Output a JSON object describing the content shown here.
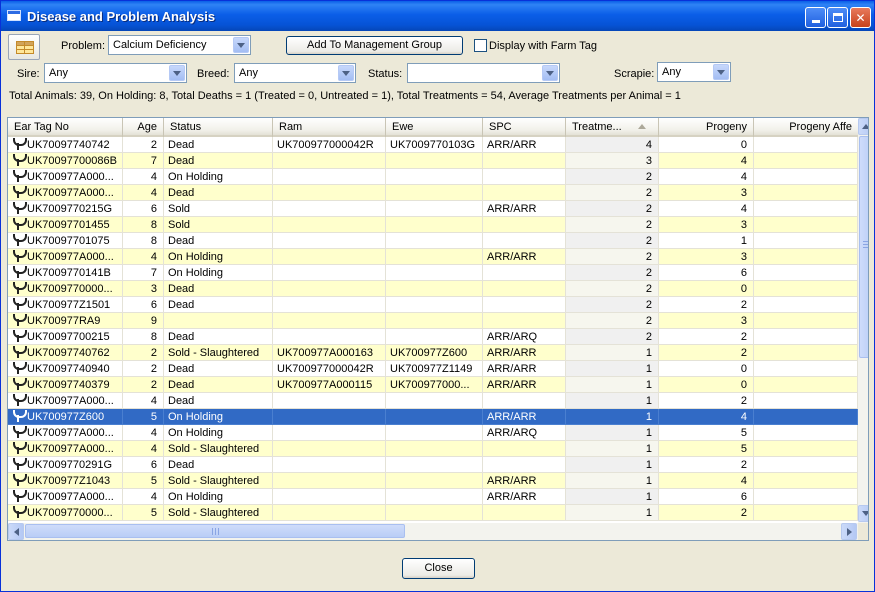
{
  "window": {
    "title": "Disease and Problem Analysis"
  },
  "toolbar": {
    "problem_label": "Problem:",
    "problem_value": "Calcium Deficiency",
    "add_button": "Add To Management Group",
    "display_farm_tag": "Display with Farm Tag",
    "sire_label": "Sire:",
    "sire_value": "Any",
    "breed_label": "Breed:",
    "breed_value": "Any",
    "status_label": "Status:",
    "status_value": "",
    "scrapie_label": "Scrapie:",
    "scrapie_value": "Any"
  },
  "summary": "Total Animals: 39, On Holding: 8, Total Deaths = 1 (Treated = 0, Untreated = 1), Total Treatments = 54, Average Treatments per Animal = 1",
  "table": {
    "columns": [
      "Ear Tag No",
      "Age",
      "Status",
      "Ram",
      "Ewe",
      "SPC",
      "Treatme...",
      "Progeny",
      "Progeny Affe"
    ],
    "rows": [
      [
        "UK70097740742",
        "2",
        "Dead",
        "UK700977000042R",
        "UK7009770103G",
        "ARR/ARR",
        "4",
        "0"
      ],
      [
        "UK70097700086B",
        "7",
        "Dead",
        "",
        "",
        "",
        "3",
        "4"
      ],
      [
        "UK700977A000...",
        "4",
        "On Holding",
        "",
        "",
        "",
        "2",
        "4"
      ],
      [
        "UK700977A000...",
        "4",
        "Dead",
        "",
        "",
        "",
        "2",
        "3"
      ],
      [
        "UK7009770215G",
        "6",
        "Sold",
        "",
        "",
        "ARR/ARR",
        "2",
        "4"
      ],
      [
        "UK70097701455",
        "8",
        "Sold",
        "",
        "",
        "",
        "2",
        "3"
      ],
      [
        "UK70097701075",
        "8",
        "Dead",
        "",
        "",
        "",
        "2",
        "1"
      ],
      [
        "UK700977A000...",
        "4",
        "On Holding",
        "",
        "",
        "ARR/ARR",
        "2",
        "3"
      ],
      [
        "UK7009770141B",
        "7",
        "On Holding",
        "",
        "",
        "",
        "2",
        "6"
      ],
      [
        "UK7009770000...",
        "3",
        "Dead",
        "",
        "",
        "",
        "2",
        "0"
      ],
      [
        "UK700977Z1501",
        "6",
        "Dead",
        "",
        "",
        "",
        "2",
        "2"
      ],
      [
        "UK700977RA9",
        "9",
        "",
        "",
        "",
        "",
        "2",
        "3"
      ],
      [
        "UK70097700215",
        "8",
        "Dead",
        "",
        "",
        "ARR/ARQ",
        "2",
        "2"
      ],
      [
        "UK70097740762",
        "2",
        "Sold - Slaughtered",
        "UK700977A000163",
        "UK700977Z600",
        "ARR/ARR",
        "1",
        "2"
      ],
      [
        "UK70097740940",
        "2",
        "Dead",
        "UK700977000042R",
        "UK700977Z1149",
        "ARR/ARR",
        "1",
        "0"
      ],
      [
        "UK70097740379",
        "2",
        "Dead",
        "UK700977A000115",
        "UK700977000...",
        "ARR/ARR",
        "1",
        "0"
      ],
      [
        "UK700977A000...",
        "4",
        "Dead",
        "",
        "",
        "",
        "1",
        "2"
      ],
      [
        "UK700977Z600",
        "5",
        "On Holding",
        "",
        "",
        "ARR/ARR",
        "1",
        "4"
      ],
      [
        "UK700977A000...",
        "4",
        "On Holding",
        "",
        "",
        "ARR/ARQ",
        "1",
        "5"
      ],
      [
        "UK700977A000...",
        "4",
        "Sold - Slaughtered",
        "",
        "",
        "",
        "1",
        "5"
      ],
      [
        "UK7009770291G",
        "6",
        "Dead",
        "",
        "",
        "",
        "1",
        "2"
      ],
      [
        "UK700977Z1043",
        "5",
        "Sold - Slaughtered",
        "",
        "",
        "ARR/ARR",
        "1",
        "4"
      ],
      [
        "UK700977A000...",
        "4",
        "On Holding",
        "",
        "",
        "ARR/ARR",
        "1",
        "6"
      ],
      [
        "UK7009770000...",
        "5",
        "Sold - Slaughtered",
        "",
        "",
        "",
        "1",
        "2"
      ]
    ],
    "selected_row": 17
  },
  "footer": {
    "close_button": "Close"
  },
  "colors": {
    "row_alt": "#ffffcc",
    "selection": "#316ac5",
    "titlebar": "#0653d6"
  }
}
